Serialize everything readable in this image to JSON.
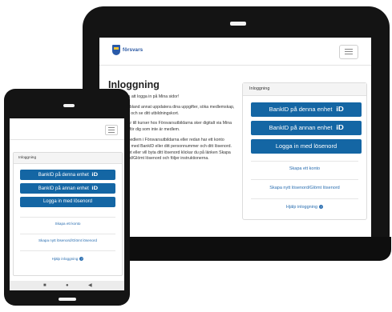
{
  "site": {
    "logo_text": "försvars"
  },
  "tablet": {
    "title": "Inloggning",
    "paragraphs": [
      "Välkommen att logga in på Mina sidor!",
      "Här kan du bland annat uppdatera dina uppgifter, söka medlemskap, söka kurser och se ditt utbildningskort.",
      "Anmälningar till kurser hos Försvarsutbildarna sker digitalt via Mina sidor, även för dig som inte är medlem.",
      "Om du är medlem i Försvarsutbildarna eller redan har ett konto loggar du in med BankID eller ditt personnummer och ditt lösenord. Har du glömt eller vill byta ditt lösenord klickar du på länken Skapa nytt lösenord/Glömt lösenord och följer instruktionerna."
    ],
    "card": {
      "heading": "Inloggning",
      "btn_bankid_this": "BankID på denna enhet",
      "btn_bankid_other": "BankID på annan enhet",
      "btn_password": "Logga in med lösenord",
      "link_create": "Skapa ett konto",
      "link_reset": "Skapa nytt lösenord/Glömt lösenord",
      "link_help": "Hjälp inloggning"
    }
  },
  "phone": {
    "card": {
      "heading": "Inloggning",
      "btn_bankid_this": "BankID på denna enhet",
      "btn_bankid_other": "BankID på annan enhet",
      "btn_password": "Logga in med lösenord",
      "link_create": "Skapa ett konto",
      "link_reset": "Skapa nytt lösenord/Glömt lösenord",
      "link_help": "Hjälp inloggning"
    },
    "nav": {
      "home": "■",
      "circle": "●",
      "back": "◀"
    }
  },
  "icons": {
    "bankid": "iD",
    "help": "?"
  },
  "colors": {
    "primary_button": "#1466a4",
    "link": "#2a6eb0",
    "logo_blue": "#2a5aa8",
    "logo_yellow": "#f2c230"
  }
}
